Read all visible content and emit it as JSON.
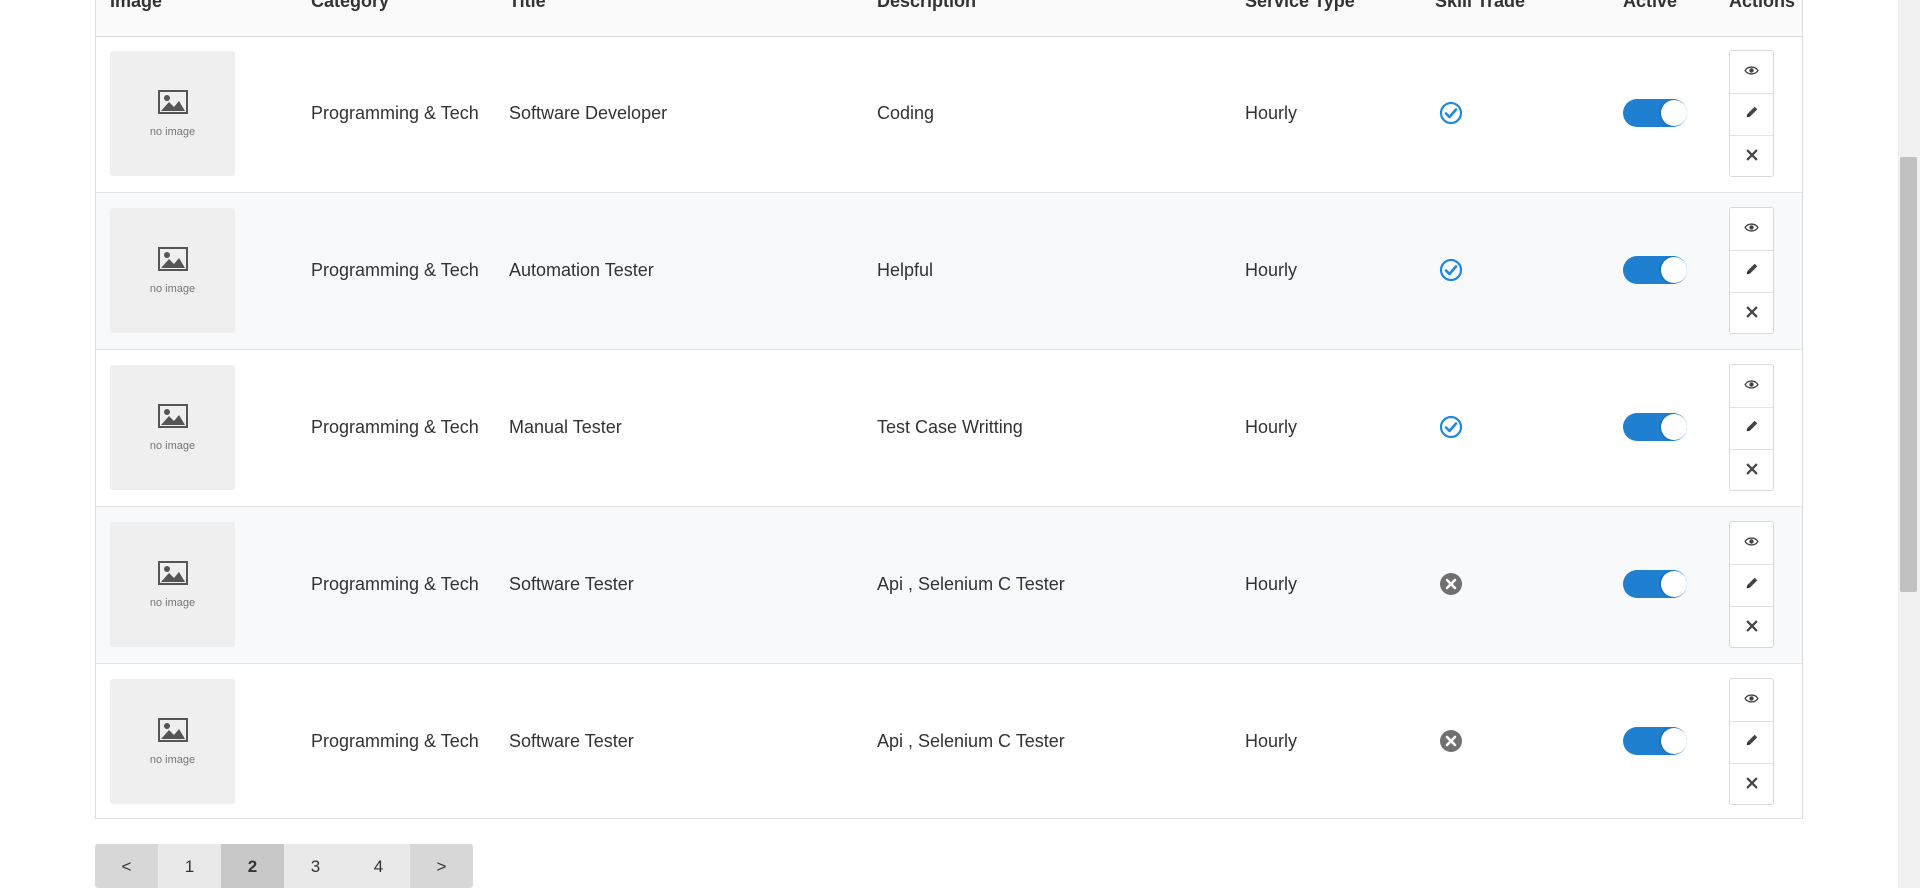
{
  "table": {
    "headers": {
      "image": "Image",
      "category": "Category",
      "title": "Title",
      "description": "Description",
      "service_type": "Service Type",
      "skill_trade": "Skill Trade",
      "active": "Active",
      "actions": "Actions"
    },
    "rows": [
      {
        "image_text": "no image",
        "category": "Programming & Tech",
        "title": "Software Developer",
        "description": "Coding",
        "service_type": "Hourly",
        "skill_trade": true,
        "active": true
      },
      {
        "image_text": "no image",
        "category": "Programming & Tech",
        "title": "Automation Tester",
        "description": "Helpful",
        "service_type": "Hourly",
        "skill_trade": true,
        "active": true
      },
      {
        "image_text": "no image",
        "category": "Programming & Tech",
        "title": "Manual Tester",
        "description": "Test Case Writting",
        "service_type": "Hourly",
        "skill_trade": true,
        "active": true
      },
      {
        "image_text": "no image",
        "category": "Programming & Tech",
        "title": "Software Tester",
        "description": "Api , Selenium C Tester",
        "service_type": "Hourly",
        "skill_trade": false,
        "active": true
      },
      {
        "image_text": "no image",
        "category": "Programming & Tech",
        "title": "Software Tester",
        "description": "Api , Selenium C Tester",
        "service_type": "Hourly",
        "skill_trade": false,
        "active": true
      }
    ],
    "action_icons": [
      "eye-icon",
      "pencil-icon",
      "close-icon"
    ]
  },
  "pagination": {
    "prev": "<",
    "pages": [
      "1",
      "2",
      "3",
      "4"
    ],
    "current": "2",
    "next": ">"
  },
  "colors": {
    "accent": "#1f7fd0",
    "check": "#1e88e5",
    "cross": "#707070"
  }
}
